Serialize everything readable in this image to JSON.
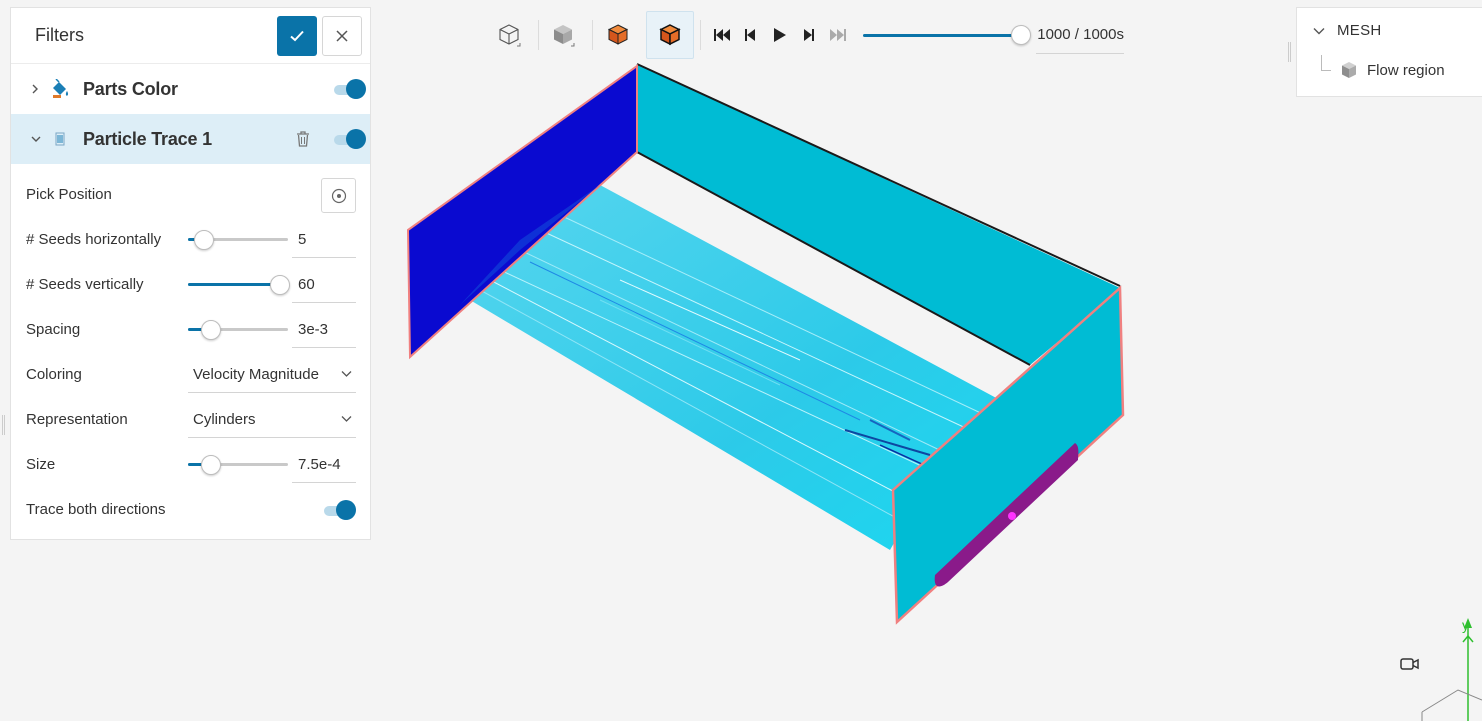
{
  "filters_panel": {
    "title": "Filters",
    "items": [
      {
        "label": "Parts Color",
        "expanded": false,
        "enabled": true
      },
      {
        "label": "Particle Trace 1",
        "expanded": true,
        "enabled": true,
        "selected": true
      }
    ],
    "properties": {
      "pick_position_label": "Pick Position",
      "seeds_h_label": "# Seeds horizontally",
      "seeds_h_value": "5",
      "seeds_h_level": 0.16,
      "seeds_v_label": "# Seeds vertically",
      "seeds_v_value": "60",
      "seeds_v_level": 0.92,
      "spacing_label": "Spacing",
      "spacing_value": "3e-3",
      "spacing_level": 0.23,
      "coloring_label": "Coloring",
      "coloring_value": "Velocity Magnitude",
      "representation_label": "Representation",
      "representation_value": "Cylinders",
      "size_label": "Size",
      "size_value": "7.5e-4",
      "size_level": 0.23,
      "trace_both_label": "Trace both directions",
      "trace_both_enabled": true
    }
  },
  "toolbar": {
    "time_text": "1000 / 1000s",
    "time_level": 1.0
  },
  "mesh_panel": {
    "title": "MESH",
    "items": [
      {
        "label": "Flow region"
      }
    ]
  },
  "colors": {
    "accent": "#0a73a8",
    "selected_row": "#ddeef7",
    "wall_cyan": "#00bcd4",
    "inlet_blue": "#0a0ad0",
    "outlet_purple": "#8a1a8a",
    "highlight_edge": "#f08080"
  },
  "axes": {
    "y_label": "y"
  }
}
